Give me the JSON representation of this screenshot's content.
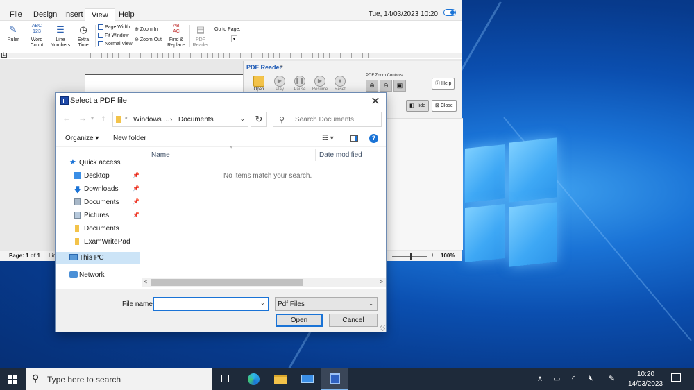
{
  "app": {
    "menu": [
      "File",
      "Design",
      "Insert",
      "View",
      "Help"
    ],
    "active_menu": "View",
    "datetime": "Tue, 14/03/2023 10:20",
    "ribbon": {
      "ruler": "Ruler",
      "word_count_1": "Word",
      "word_count_2": "Count",
      "word_count_icon": "ABC 123",
      "line_numbers_1": "Line",
      "line_numbers_2": "Numbers",
      "extra_time_1": "Extra",
      "extra_time_2": "Time",
      "page_width": "Page Width",
      "fit_window": "Fit Window",
      "normal_view": "Normal View",
      "zoom_in": "Zoom In",
      "zoom_out": "Zoom Out",
      "find_replace_1": "Find &",
      "find_replace_2": "Replace",
      "find_replace_icon": "AB AC",
      "pdf_reader_1": "PDF",
      "pdf_reader_2": "Reader",
      "go_to_page": "Go to Page:"
    },
    "pdf_panel": {
      "title": "PDF Reader",
      "controls": [
        "Open",
        "Play",
        "Pause",
        "Resume",
        "Reset"
      ],
      "zoom_controls_label": "PDF Zoom Controls",
      "help": "Help",
      "hide": "Hide",
      "close": "Close"
    },
    "status": {
      "page": "Page: 1 of 1",
      "line": "Lin",
      "minus": "−",
      "plus": "+",
      "zoom": "100%"
    }
  },
  "dialog": {
    "title": "Select a PDF file",
    "address": {
      "sep": "«",
      "part1": "Windows ...",
      "chevron": "›",
      "part2": "Documents"
    },
    "search_placeholder": "Search Documents",
    "organize": "Organize ▾",
    "new_folder": "New folder",
    "nav_items": [
      {
        "label": "Quick access"
      },
      {
        "label": "Desktop"
      },
      {
        "label": "Downloads"
      },
      {
        "label": "Documents"
      },
      {
        "label": "Pictures"
      },
      {
        "label": "Documents"
      },
      {
        "label": "ExamWritePad"
      },
      {
        "label": "This PC"
      },
      {
        "label": "Network"
      }
    ],
    "columns": {
      "name": "Name",
      "date_modified": "Date modified"
    },
    "empty_message": "No items match your search.",
    "file_name_label": "File name:",
    "file_name_value": "",
    "file_type": "Pdf Files",
    "open": "Open",
    "cancel": "Cancel"
  },
  "taskbar": {
    "search_placeholder": "Type here to search",
    "time": "10:20",
    "date": "14/03/2023"
  }
}
